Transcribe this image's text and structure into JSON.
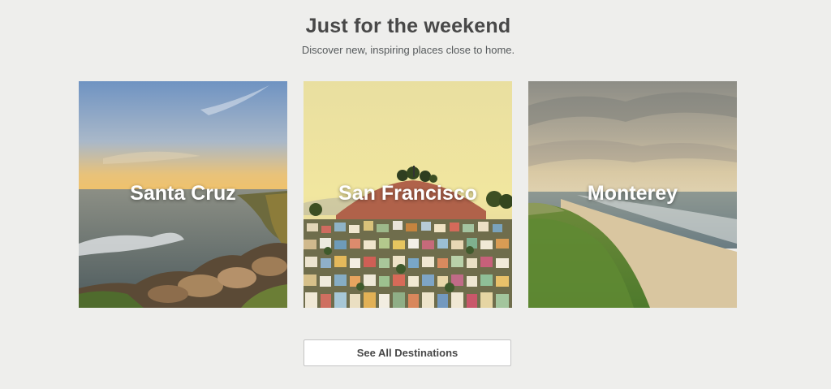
{
  "section": {
    "title": "Just for the weekend",
    "subtitle": "Discover new, inspiring places close to home."
  },
  "destinations": [
    {
      "name": "Santa Cruz",
      "image": "coastal-cliffs-sunset-photo"
    },
    {
      "name": "San Francisco",
      "image": "hillside-houses-photo"
    },
    {
      "name": "Monterey",
      "image": "beach-dunes-photo"
    }
  ],
  "cta": {
    "label": "See All Destinations"
  }
}
